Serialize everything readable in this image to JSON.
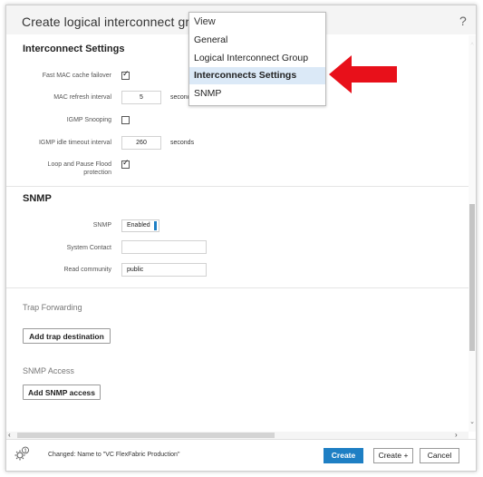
{
  "dialog": {
    "title": "Create logical interconnect group",
    "help": "?"
  },
  "interconnect_settings": {
    "title": "Interconnect Settings",
    "fast_mac_label": "Fast MAC cache failover",
    "fast_mac_checked": true,
    "mac_refresh_label": "MAC refresh interval",
    "mac_refresh_value": "5",
    "mac_refresh_unit": "seconds",
    "igmp_snooping_label": "IGMP Snooping",
    "igmp_snooping_checked": false,
    "igmp_idle_label": "IGMP idle timeout interval",
    "igmp_idle_value": "260",
    "igmp_idle_unit": "seconds",
    "loop_label_line1": "Loop and Pause Flood",
    "loop_label_line2": "protection",
    "loop_checked": true
  },
  "snmp": {
    "title": "SNMP",
    "snmp_label": "SNMP",
    "snmp_value": "Enabled",
    "system_contact_label": "System Contact",
    "system_contact_value": "",
    "read_community_label": "Read community",
    "read_community_value": "public"
  },
  "trap_forwarding": {
    "title": "Trap Forwarding",
    "add_button": "Add trap destination"
  },
  "snmp_access": {
    "title": "SNMP Access",
    "add_button": "Add SNMP access"
  },
  "footer": {
    "notification_count": "1",
    "status": "Changed: Name to \"VC FlexFabric Production\"",
    "create": "Create",
    "create_plus": "Create +",
    "cancel": "Cancel"
  },
  "view_menu": {
    "header": "View",
    "items": [
      "General",
      "Logical Interconnect Group",
      "Interconnects Settings",
      "SNMP"
    ],
    "selected": "Interconnects Settings"
  },
  "colors": {
    "primary": "#1e7fc4",
    "arrow": "#e8101a",
    "selected_bg": "#dbe9f7"
  },
  "icons": [
    "gear-icon",
    "help-icon",
    "checkbox-checked-icon",
    "red-arrow-icon"
  ]
}
